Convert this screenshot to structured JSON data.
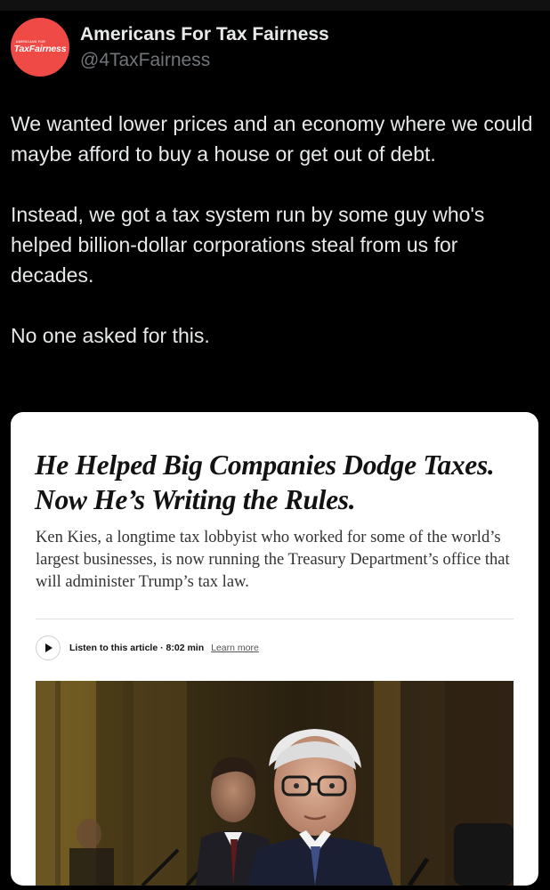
{
  "account": {
    "display_name": "Americans For Tax Fairness",
    "handle": "@4TaxFairness",
    "avatar_logo_text": "TaxFairness",
    "avatar_small_text": "AMERICANS FOR",
    "avatar_color": "#f04a46"
  },
  "tweet": {
    "paragraphs": [
      "We wanted lower prices and an economy where we could maybe afford to buy a house or get out of debt.",
      "Instead, we got a tax system run by some guy who's helped billion-dollar corporations steal from us for decades.",
      "No one asked for this."
    ]
  },
  "article": {
    "headline": "He Helped Big Companies Dodge Taxes. Now He’s Writing the Rules.",
    "summary": "Ken Kies, a longtime tax lobbyist who worked for some of the world’s largest businesses, is now running the Treasury Department’s office that will administer Trump’s tax law.",
    "listen_label": "Listen to this article · 8:02 min",
    "learn_more_label": "Learn more"
  },
  "colors": {
    "background": "#000000",
    "text_primary": "#e7e9ea",
    "text_secondary": "#71767b",
    "card_background": "#ffffff"
  },
  "icons": {
    "play": "play-icon"
  }
}
